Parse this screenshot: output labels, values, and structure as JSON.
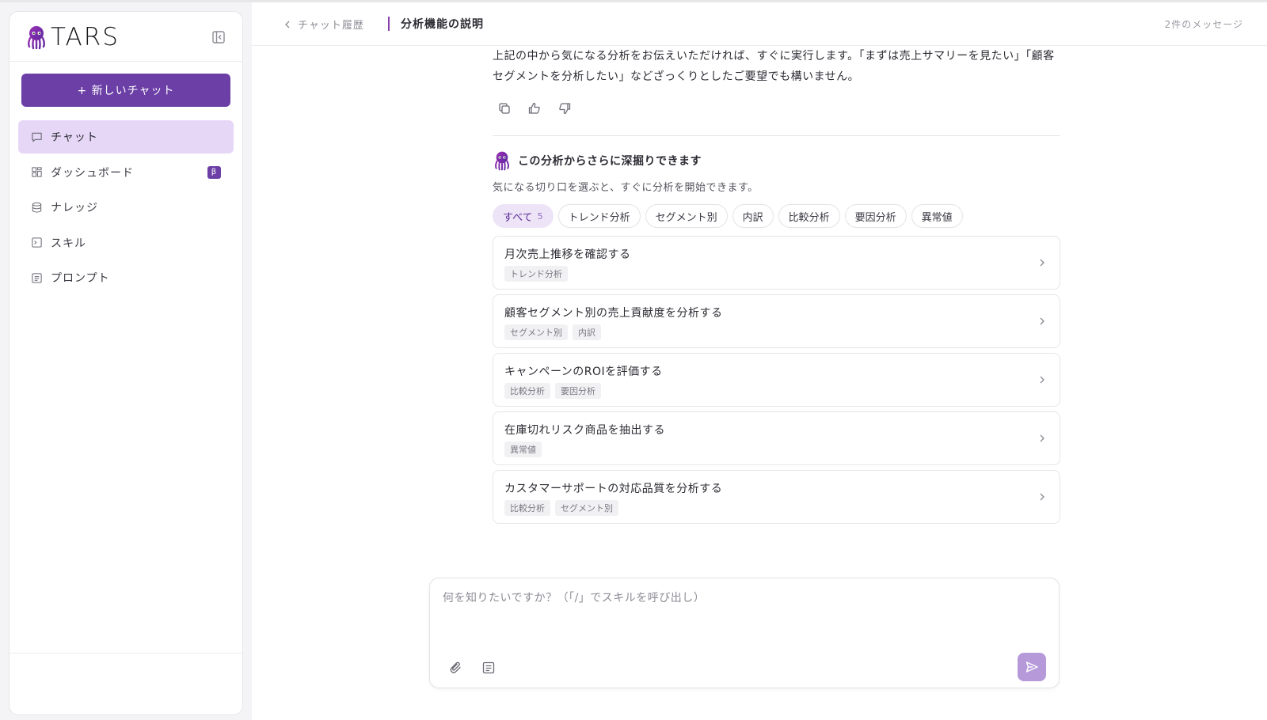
{
  "app": {
    "brand_name": "TARS",
    "logo_icon": "octopus-logo-icon"
  },
  "sidebar": {
    "new_chat_label": "+ 新しいチャット",
    "items": [
      {
        "label": "チャット",
        "icon": "chat-bubble-icon",
        "active": true
      },
      {
        "label": "ダッシュボード",
        "icon": "dashboard-grid-icon",
        "badge": "β"
      },
      {
        "label": "ナレッジ",
        "icon": "database-icon"
      },
      {
        "label": "スキル",
        "icon": "terminal-icon"
      },
      {
        "label": "プロンプト",
        "icon": "document-lines-icon"
      }
    ]
  },
  "header": {
    "back_label": "チャット履歴",
    "title": "分析機能の説明",
    "message_count": "2件のメッセージ"
  },
  "message": {
    "text": "上記の中から気になる分析をお伝えいただければ、すぐに実行します。「まずは売上サマリーを見たい」「顧客セグメントを分析したい」などざっくりとしたご要望でも構いません。"
  },
  "suggestions": {
    "title": "この分析からさらに深掘りできます",
    "subtitle": "気になる切り口を選ぶと、すぐに分析を開始できます。",
    "filters": [
      {
        "label": "すべて",
        "count": "5",
        "active": true
      },
      {
        "label": "トレンド分析"
      },
      {
        "label": "セグメント別"
      },
      {
        "label": "内訳"
      },
      {
        "label": "比較分析"
      },
      {
        "label": "要因分析"
      },
      {
        "label": "異常値"
      }
    ],
    "cards": [
      {
        "title": "月次売上推移を確認する",
        "tags": [
          "トレンド分析"
        ]
      },
      {
        "title": "顧客セグメント別の売上貢献度を分析する",
        "tags": [
          "セグメント別",
          "内訳"
        ]
      },
      {
        "title": "キャンペーンのROIを評価する",
        "tags": [
          "比較分析",
          "要因分析"
        ]
      },
      {
        "title": "在庫切れリスク商品を抽出する",
        "tags": [
          "異常値"
        ]
      },
      {
        "title": "カスタマーサポートの対応品質を分析する",
        "tags": [
          "比較分析",
          "セグメント別"
        ]
      }
    ]
  },
  "composer": {
    "placeholder": "何を知りたいですか？（「/」でスキルを呼び出し）",
    "value": ""
  },
  "colors": {
    "accent": "#6b3fa6",
    "active_nav": "#e6d7f7",
    "send_button": "#b599d9"
  }
}
